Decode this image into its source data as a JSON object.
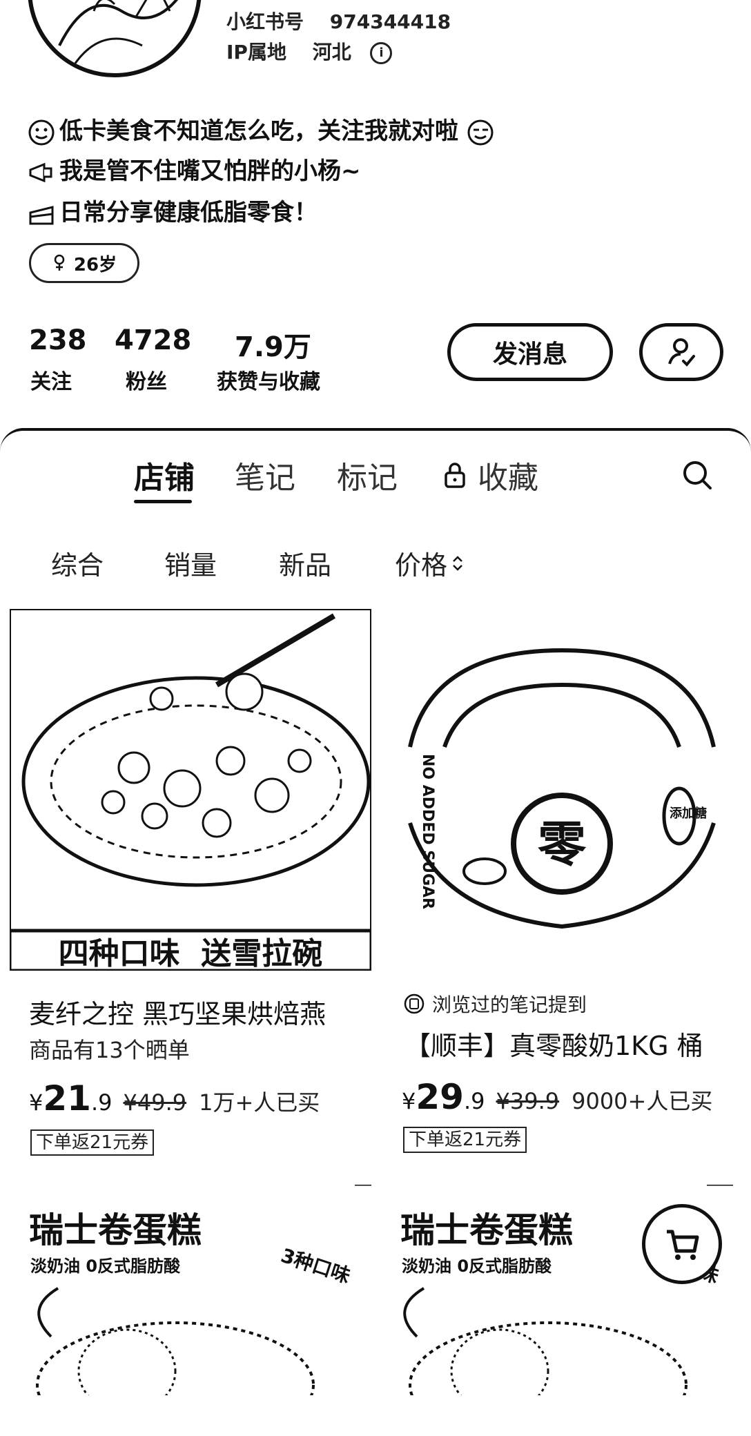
{
  "profile": {
    "id_label": "小红书号",
    "id_value": "974344418",
    "ip_label": "IP属地",
    "ip_value": "河北",
    "bio": [
      "低卡美食不知道怎么吃，关注我就对啦",
      "我是管不住嘴又怕胖的小杨~",
      "日常分享健康低脂零食！"
    ],
    "age_tag": "26岁",
    "stats": [
      {
        "value": "238",
        "label": "关注"
      },
      {
        "value": "4728",
        "label": "粉丝"
      },
      {
        "value": "7.9万",
        "label": "获赞与收藏"
      }
    ],
    "message_button": "发消息"
  },
  "tabs": [
    {
      "label": "店铺",
      "active": true
    },
    {
      "label": "笔记",
      "active": false
    },
    {
      "label": "标记",
      "active": false
    },
    {
      "label": "收藏",
      "active": false,
      "icon": "lock-icon"
    }
  ],
  "sort_options": [
    "综合",
    "销量",
    "新品",
    "价格"
  ],
  "products": [
    {
      "image_overlay": "四种口味  送雪拉碗",
      "title": "麦纤之控 黑巧坚果烘焙燕",
      "subtitle": "商品有13个晒单",
      "price_currency": "¥",
      "price_int": "21",
      "price_dec": ".9",
      "price_orig": "¥49.9",
      "sold": "1万+人已买",
      "coupon": "下单返21元券"
    },
    {
      "image_text_side": "NO ADDED SUGAR",
      "image_text_zero": "添加糖",
      "mention": "浏览过的笔记提到",
      "title": "【顺丰】真零酸奶1KG 桶",
      "price_currency": "¥",
      "price_int": "29",
      "price_dec": ".9",
      "price_orig": "¥39.9",
      "sold": "9000+人已买",
      "coupon": "下单返21元券"
    },
    {
      "image_title": "瑞士卷蛋糕",
      "image_sub": "淡奶油 0反式脂肪酸",
      "image_tag": "3种口味"
    },
    {
      "image_title": "瑞士卷蛋糕",
      "image_sub": "淡奶油 0反式脂肪酸",
      "image_tag": "3种口味"
    }
  ]
}
